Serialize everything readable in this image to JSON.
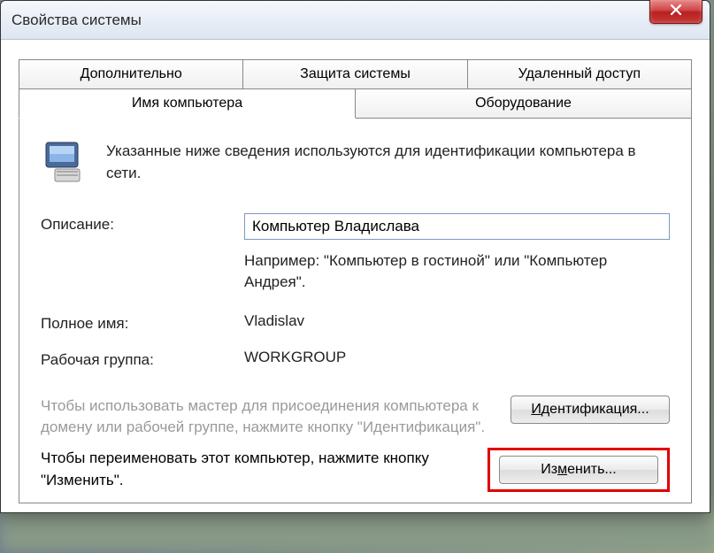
{
  "window": {
    "title": "Свойства системы"
  },
  "tabs": {
    "row1": [
      {
        "label": "Дополнительно"
      },
      {
        "label": "Защита системы"
      },
      {
        "label": "Удаленный доступ"
      }
    ],
    "row2": [
      {
        "label": "Имя компьютера",
        "active": true
      },
      {
        "label": "Оборудование"
      }
    ]
  },
  "intro": "Указанные ниже сведения используются для идентификации компьютера в сети.",
  "form": {
    "description_label": "Описание:",
    "description_value": "Компьютер Владислава",
    "description_hint": "Например: \"Компьютер в гостиной\" или \"Компьютер Андрея\".",
    "fullname_label": "Полное имя:",
    "fullname_value": "Vladislav",
    "workgroup_label": "Рабочая группа:",
    "workgroup_value": "WORKGROUP"
  },
  "actions": {
    "identify_text": "Чтобы использовать мастер для присоединения компьютера к домену или рабочей группе, нажмите кнопку \"Идентификация\".",
    "identify_button": "Идентификация...",
    "change_text": "Чтобы переименовать этот компьютер, нажмите кнопку \"Изменить\".",
    "change_button": "Изменить..."
  }
}
